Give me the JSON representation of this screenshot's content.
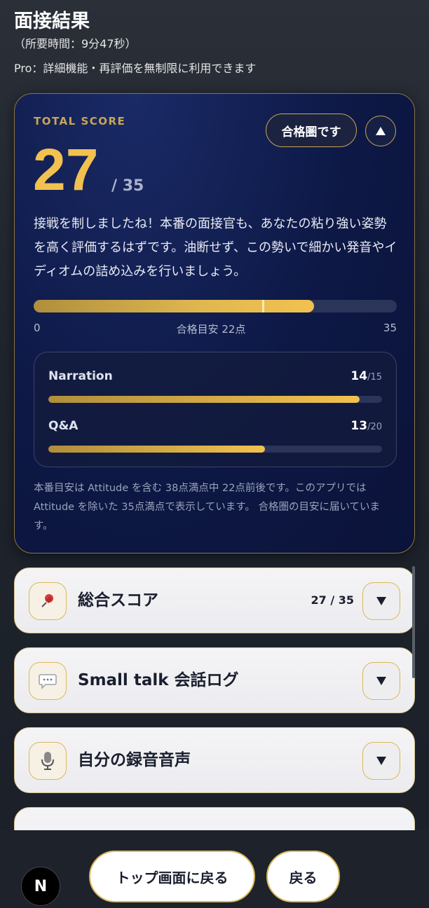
{
  "header": {
    "title": "面接結果",
    "duration": "（所要時間：9分47秒）",
    "pro_note": "Pro：詳細機能・再評価を無制限に利用できます"
  },
  "score_card": {
    "label": "TOTAL SCORE",
    "badge": "合格圏です",
    "collapse_icon": "triangle-up",
    "score": "27",
    "max": "/ 35",
    "message": "接戦を制しましたね！本番の面接官も、あなたの粘り強い姿勢を高く評価するはずです。油断せず、この勢いで細かい発音やイディオムの詰め込みを行いましょう。",
    "progress": {
      "value": 27,
      "max": 35,
      "pass_line": 22
    },
    "bar_min": "0",
    "bar_guide": "合格目安 22点",
    "bar_max": "35",
    "breakdown": [
      {
        "name": "Narration",
        "score": "14",
        "max": "/15",
        "value": 14,
        "out_of": 15
      },
      {
        "name": "Q&A",
        "score": "13",
        "max": "/20",
        "value": 13,
        "out_of": 20
      }
    ],
    "footnote": "本番目安は Attitude を含む 38点満点中 22点前後です。このアプリでは Attitude を除いた 35点満点で表示しています。 合格圏の目安に届いています。"
  },
  "sections": [
    {
      "title": "総合スコア",
      "value": "27 / 35",
      "icon": "pushpin-icon"
    },
    {
      "title": "Small talk 会話ログ",
      "value": "",
      "icon": "speech-bubble-icon"
    },
    {
      "title": "自分の録音音声",
      "value": "",
      "icon": "microphone-icon"
    }
  ],
  "footer": {
    "top_button": "トップ画面に戻る",
    "back_button": "戻る",
    "logo": "N"
  },
  "colors": {
    "accent_gold": "#f2c14f",
    "card_navy": "#0d1845",
    "border_gold": "#d9b85a"
  }
}
